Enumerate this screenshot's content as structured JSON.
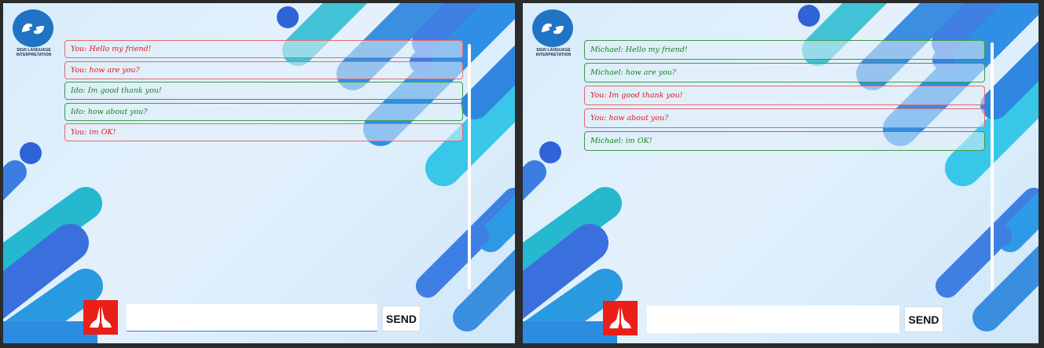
{
  "colors": {
    "you_message": "#e0191e",
    "other_message": "#13861b",
    "logo_blue": "#1f74c4",
    "hand_icon_bg": "#ea1f1a",
    "scrollbar": "#ffffff"
  },
  "logo": {
    "icon": "sign-language-hands-icon",
    "caption": "SIGN LANGUAGE\nINTERPRETATION"
  },
  "composer": {
    "icon": "praying-hands-icon",
    "input_value": "",
    "send_label": "SEND"
  },
  "left_chat": {
    "messages": [
      {
        "sender": "you",
        "text": "You: Hello my friend!"
      },
      {
        "sender": "you",
        "text": "You: how are you?"
      },
      {
        "sender": "other",
        "text": "Ido: Im good thank you!"
      },
      {
        "sender": "other",
        "text": "Ido: how about you?"
      },
      {
        "sender": "you",
        "text": "You: im OK!"
      }
    ]
  },
  "right_chat": {
    "messages": [
      {
        "sender": "other",
        "text": "Michael: Hello my friend!"
      },
      {
        "sender": "other",
        "text": "Michael: how are you?"
      },
      {
        "sender": "you",
        "text": "You: Im good thank you!"
      },
      {
        "sender": "you",
        "text": "You: how about you?"
      },
      {
        "sender": "other",
        "text": "Michael: im OK!"
      }
    ]
  }
}
